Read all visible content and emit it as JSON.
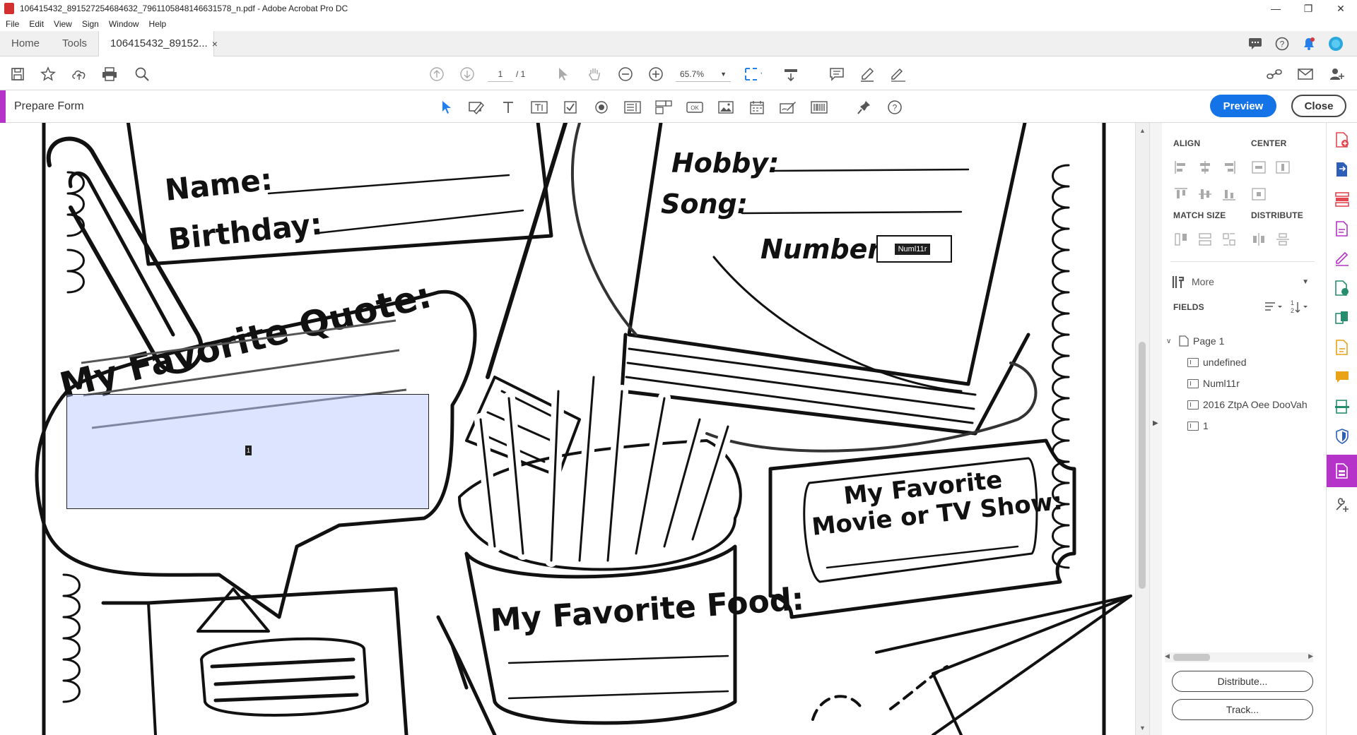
{
  "window": {
    "title": "106415432_891527254684632_7961105848146631578_n.pdf - Adobe Acrobat Pro DC",
    "controls": [
      "minimize",
      "restore",
      "close"
    ]
  },
  "menu": {
    "items": [
      "File",
      "Edit",
      "View",
      "Sign",
      "Window",
      "Help"
    ]
  },
  "tabs": {
    "home": "Home",
    "tools": "Tools",
    "doc": "106415432_89152...",
    "doc_close": "×"
  },
  "toolbar": {
    "page_current": "1",
    "page_count": "/ 1",
    "zoom": "65.7%"
  },
  "form_bar": {
    "label": "Prepare Form",
    "preview": "Preview",
    "close": "Close"
  },
  "panel": {
    "align_heading": "ALIGN",
    "center_heading": "CENTER",
    "match_size_heading": "MATCH SIZE",
    "distribute_heading": "DISTRIBUTE",
    "more_label": "More",
    "fields_heading": "FIELDS",
    "page_node": "Page 1",
    "fields": [
      "undefined",
      "Numl11r",
      "2016 ZtpA Oee DooVah",
      "1"
    ],
    "distribute_button": "Distribute...",
    "track_button": "Track..."
  },
  "document": {
    "labels": {
      "name": "Name:",
      "birthday": "Birthday:",
      "hobby": "Hobby:",
      "song": "Song:",
      "number": "Number:",
      "quote": "My Favorite Quote:",
      "food": "My Favorite Food:",
      "movie_line1": "My Favorite",
      "movie_line2": "Movie or TV Show:"
    },
    "field_number_name": "Numl11r",
    "field_quote_name": "1"
  },
  "colors": {
    "accent_purple": "#b633c9",
    "preview_blue": "#1473e6",
    "field_fill": "#c8d2ff"
  }
}
